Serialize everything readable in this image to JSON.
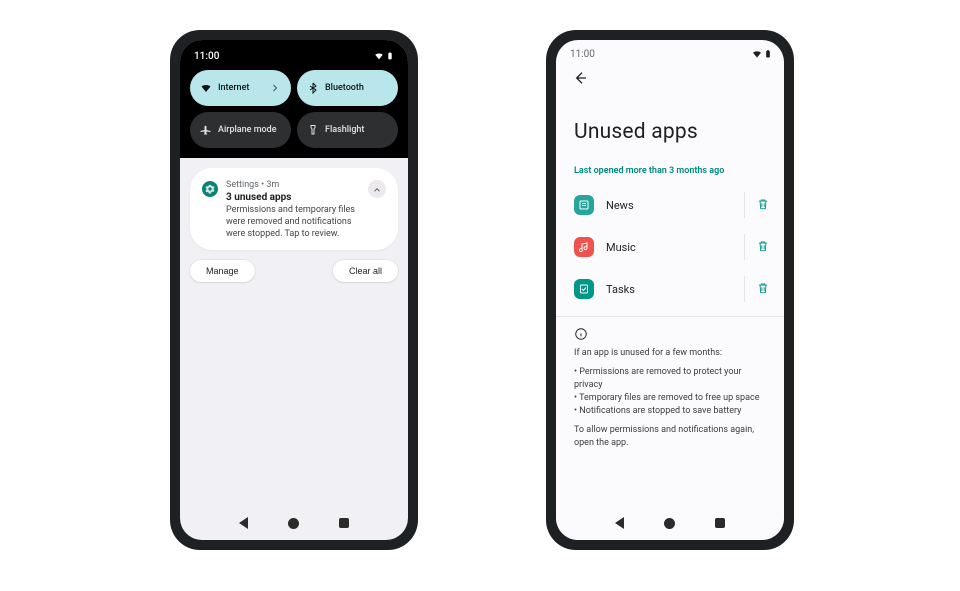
{
  "left": {
    "status": {
      "time": "11:00"
    },
    "qs": [
      {
        "label": "Internet",
        "icon": "wifi",
        "state": "on",
        "chevron": true
      },
      {
        "label": "Bluetooth",
        "icon": "bluetooth",
        "state": "on",
        "chevron": false
      },
      {
        "label": "Airplane mode",
        "icon": "airplane",
        "state": "off",
        "chevron": false
      },
      {
        "label": "Flashlight",
        "icon": "flashlight",
        "state": "off",
        "chevron": false
      }
    ],
    "notification": {
      "meta": "Settings • 3m",
      "title": "3 unused apps",
      "body": "Permissions and temporary files were removed and notifications were stopped. Tap to review.",
      "actions": {
        "manage": "Manage",
        "clear": "Clear all"
      }
    }
  },
  "right": {
    "status": {
      "time": "11:00"
    },
    "title": "Unused apps",
    "section_label": "Last opened more than 3 months ago",
    "apps": [
      {
        "name": "News",
        "icon": "news"
      },
      {
        "name": "Music",
        "icon": "music"
      },
      {
        "name": "Tasks",
        "icon": "tasks"
      }
    ],
    "info": {
      "lead": "If an app is unused for a few months:",
      "bullets": [
        "Permissions are removed to protect your privacy",
        "Temporary files are removed to free up space",
        "Notifications are stopped to save battery"
      ],
      "trail": "To allow permissions and notifications again, open the app."
    }
  }
}
